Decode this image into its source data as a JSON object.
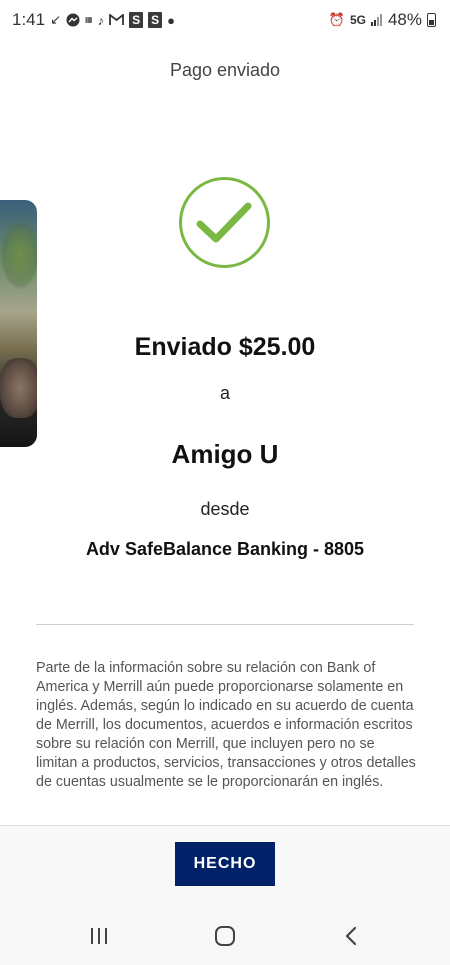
{
  "status_bar": {
    "time": "1:41",
    "network": "5G",
    "battery": "48%",
    "icons": [
      "missed-call-icon",
      "messenger-icon",
      "temu-icon",
      "tiktok-icon",
      "gmail-icon",
      "s-app-icon",
      "s-app-icon",
      "dot-icon",
      "alarm-icon",
      "signal-icon",
      "battery-icon"
    ]
  },
  "header": {
    "title": "Pago enviado"
  },
  "confirmation": {
    "sent_amount": "Enviado $25.00",
    "to_word": "a",
    "recipient": "Amigo U",
    "from_word": "desde",
    "account": "Adv SafeBalance Banking - 8805"
  },
  "disclaimer": "Parte de la información sobre su relación con Bank of America y Merrill aún puede proporcionarse solamente en inglés. Además, según lo indicado en su acuerdo de cuenta de Merrill, los documentos, acuerdos e información escritos sobre su relación con Merrill, que incluyen pero no se limitan a productos, servicios, transacciones y otros detalles de cuentas usualmente se le proporcionarán en inglés.",
  "footer": {
    "done_label": "HECHO"
  },
  "colors": {
    "check_green": "#78b843",
    "button_navy": "#012169"
  },
  "nav": [
    "recents-icon",
    "home-icon",
    "back-icon"
  ]
}
